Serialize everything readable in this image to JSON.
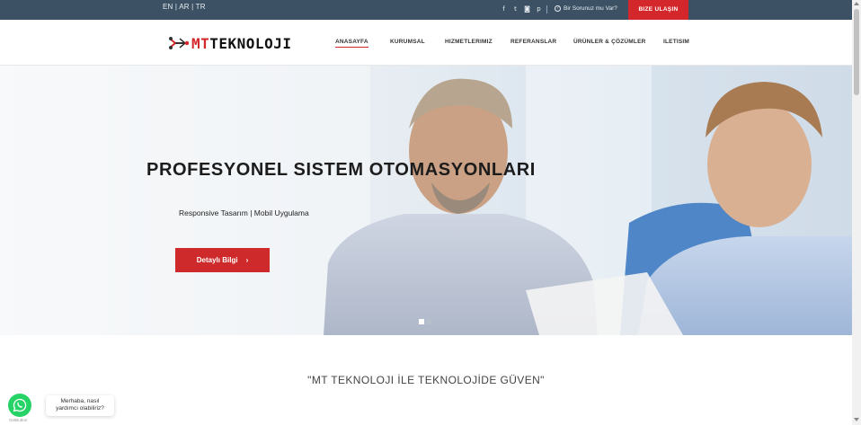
{
  "topbar": {
    "languages": "EN | AR | TR",
    "social_icons": [
      "facebook-icon",
      "twitter-icon",
      "instagram-icon",
      "pinterest-icon"
    ],
    "question_text": "Bir Sorunuz mu Var?",
    "contact_button": "BIZE ULAŞIN",
    "background": "#3c5163",
    "accent": "#d3272b"
  },
  "header": {
    "logo_mt": "MT",
    "logo_rest": "TEKNOLOJI",
    "nav": [
      {
        "label": "ANASAYFA"
      },
      {
        "label": "KURUMSAL"
      },
      {
        "label": "HIZMETLERIMIZ"
      },
      {
        "label": "REFERANSLAR"
      },
      {
        "label": "ÜRÜNLER & ÇÖZÜMLER"
      },
      {
        "label": "ILETISIM"
      }
    ]
  },
  "hero": {
    "title": "PROFESYONEL SISTEM OTOMASYONLARI",
    "subtitle": "Responsive Tasarım | Mobil Uygulama",
    "button_label": "Detaylı Bilgi",
    "button_icon": "chevron-right-icon",
    "slides_count": 2,
    "active_slide": 1
  },
  "content": {
    "tagline": "\"MT TEKNOLOJI İLE TEKNOLOJİDE GÜVEN\""
  },
  "whatsapp": {
    "bubble_line1": "Merhaba, nasıl",
    "bubble_line2": "yardımcı olabiliriz?",
    "credit": "GetButton",
    "color": "#25d366"
  }
}
